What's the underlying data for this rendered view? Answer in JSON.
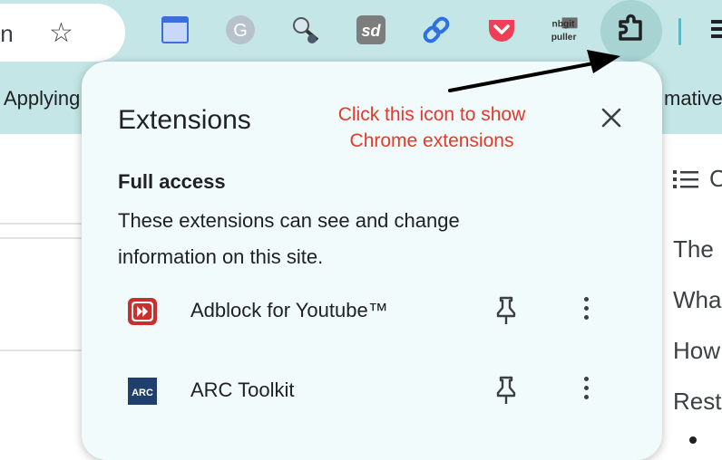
{
  "toolbar": {
    "omnibox_text": "gin",
    "extensions": [
      {
        "name": "notes-extension-icon"
      },
      {
        "name": "grammarly-icon",
        "letter": "G"
      },
      {
        "name": "magnifier-bug-icon"
      },
      {
        "name": "sd-extension-icon",
        "label": "sd"
      },
      {
        "name": "link-icon"
      },
      {
        "name": "pocket-icon"
      },
      {
        "name": "nbgitpuller-icon",
        "line1": "nbgit",
        "line2": "puller"
      }
    ],
    "colors": {
      "background": "#c5e6e6",
      "active_button": "#a8d3d3"
    }
  },
  "bookmarks": {
    "left_label": "Applying",
    "right_label": "mative"
  },
  "page": {
    "toc_partial": "C",
    "toc_items": [
      "The",
      "What",
      "How",
      "Rest"
    ]
  },
  "popup": {
    "title": "Extensions",
    "section_title": "Full access",
    "section_description": "These extensions can see and change information on this site.",
    "extensions": [
      {
        "name": "Adblock for Youtube™",
        "icon": "adblock-youtube-icon"
      },
      {
        "name": "ARC Toolkit",
        "icon": "arc-toolkit-icon",
        "logo_text": "ARC"
      }
    ]
  },
  "annotation": {
    "line1": "Click this icon to show",
    "line2": "Chrome extensions",
    "color": "#e5392b"
  }
}
